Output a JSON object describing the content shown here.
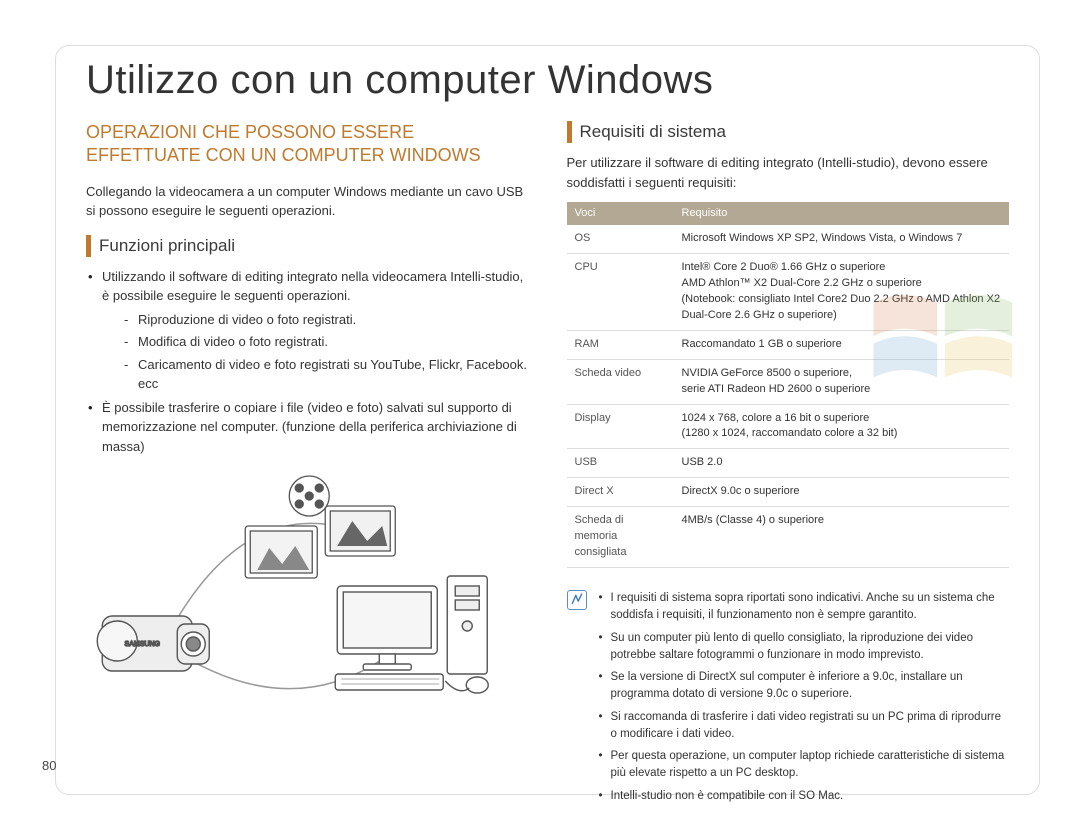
{
  "pageNumber": "80",
  "title": "Utilizzo con un computer Windows",
  "left": {
    "heading": "OPERAZIONI CHE POSSONO ESSERE EFFETTUATE CON UN COMPUTER WINDOWS",
    "intro": "Collegando la videocamera a un computer Windows mediante un cavo USB si possono eseguire le seguenti operazioni.",
    "subheading": "Funzioni principali",
    "bullet1": "Utilizzando il software di editing integrato nella videocamera Intelli-studio, è possibile eseguire le seguenti operazioni.",
    "dash1": "Riproduzione di video o foto registrati.",
    "dash2": "Modifica di video o foto registrati.",
    "dash3": "Caricamento di video e foto registrati su YouTube, Flickr, Facebook. ecc",
    "bullet2": "È possibile trasferire o copiare i file (video e foto) salvati sul supporto di memorizzazione nel computer. (funzione della periferica archiviazione di massa)"
  },
  "right": {
    "subheading": "Requisiti di sistema",
    "intro": "Per utilizzare il software di editing integrato (Intelli-studio), devono essere soddisfatti i seguenti requisiti:",
    "tableHeaders": {
      "col1": "Voci",
      "col2": "Requisito"
    },
    "rows": {
      "os": {
        "k": "OS",
        "v": "Microsoft Windows XP SP2, Windows Vista, o Windows 7"
      },
      "cpu": {
        "k": "CPU",
        "v": "Intel® Core 2 Duo® 1.66 GHz o superiore\nAMD Athlon™ X2 Dual-Core 2.2 GHz o superiore\n(Notebook: consigliato Intel Core2 Duo 2.2 GHz o AMD Athlon X2 Dual-Core 2.6 GHz o superiore)"
      },
      "ram": {
        "k": "RAM",
        "v": "Raccomandato 1 GB o superiore"
      },
      "video": {
        "k": "Scheda video",
        "v": "NVIDIA GeForce 8500 o superiore,\nserie ATI Radeon HD 2600 o superiore"
      },
      "disp": {
        "k": "Display",
        "v": "1024 x 768, colore a 16 bit o superiore\n(1280 x 1024, raccomandato colore a 32 bit)"
      },
      "usb": {
        "k": "USB",
        "v": "USB 2.0"
      },
      "dx": {
        "k": "Direct X",
        "v": "DirectX 9.0c o superiore"
      },
      "sd": {
        "k": "Scheda di memoria consigliata",
        "v": "4MB/s (Classe 4) o superiore"
      }
    },
    "notes": {
      "n1": "I requisiti di sistema sopra riportati sono indicativi. Anche su un sistema che soddisfa i requisiti, il funzionamento non è sempre garantito.",
      "n2": "Su un computer più lento di quello consigliato, la riproduzione dei video potrebbe saltare fotogrammi o funzionare in modo imprevisto.",
      "n3": "Se la versione di DirectX sul computer è inferiore a 9.0c, installare un programma dotato di versione 9.0c o superiore.",
      "n4": "Si raccomanda di trasferire i dati video registrati su un PC prima di riprodurre o modificare i dati video.",
      "n5": "Per questa operazione, un computer laptop richiede caratteristiche di sistema più elevate rispetto a un PC desktop.",
      "n6": "Intelli-studio non è compatibile con il SO Mac."
    }
  }
}
